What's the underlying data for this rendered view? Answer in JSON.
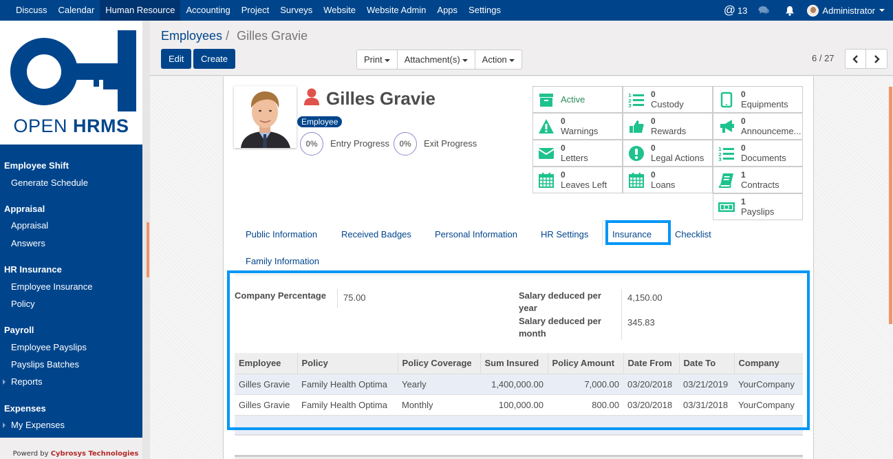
{
  "topbar": {
    "menu": [
      "Discuss",
      "Calendar",
      "Human Resource",
      "Accounting",
      "Project",
      "Surveys",
      "Website",
      "Website Admin",
      "Apps",
      "Settings"
    ],
    "active_index": 2,
    "mentions_count": "13",
    "user": "Administrator"
  },
  "logo": {
    "text_light": "OPEN ",
    "text_bold": "HRMS"
  },
  "sidebar": {
    "sections": [
      {
        "title": "Employee Shift",
        "items": [
          {
            "label": "Generate Schedule",
            "expandable": false
          }
        ]
      },
      {
        "title": "Appraisal",
        "items": [
          {
            "label": "Appraisal",
            "expandable": false
          },
          {
            "label": "Answers",
            "expandable": false
          }
        ]
      },
      {
        "title": "HR Insurance",
        "items": [
          {
            "label": "Employee Insurance",
            "expandable": false
          },
          {
            "label": "Policy",
            "expandable": false
          }
        ]
      },
      {
        "title": "Payroll",
        "items": [
          {
            "label": "Employee Payslips",
            "expandable": false
          },
          {
            "label": "Payslips Batches",
            "expandable": false
          },
          {
            "label": "Reports",
            "expandable": true
          }
        ]
      },
      {
        "title": "Expenses",
        "items": [
          {
            "label": "My Expenses",
            "expandable": true
          }
        ]
      }
    ],
    "powered_prefix": "Powerd by ",
    "powered_brand": "Cybrosys Technologies"
  },
  "control": {
    "breadcrumb_parent": "Employees",
    "breadcrumb_sep": "/",
    "breadcrumb_current": "Gilles Gravie",
    "edit_label": "Edit",
    "create_label": "Create",
    "print_label": "Print",
    "attachments_label": "Attachment(s)",
    "action_label": "Action",
    "pager": "6 / 27"
  },
  "employee": {
    "name": "Gilles Gravie",
    "tag": "Employee",
    "entry_progress": "0%",
    "entry_label": "Entry Progress",
    "exit_progress": "0%",
    "exit_label": "Exit Progress"
  },
  "stats": [
    {
      "icon": "archive-icon",
      "value": "",
      "label": "Active"
    },
    {
      "icon": "ordered-list-icon",
      "value": "0",
      "label": "Custody"
    },
    {
      "icon": "tablet-icon",
      "value": "0",
      "label": "Equipments"
    },
    {
      "icon": "warning-icon",
      "value": "0",
      "label": "Warnings"
    },
    {
      "icon": "thumbs-up-icon",
      "value": "0",
      "label": "Rewards"
    },
    {
      "icon": "bullhorn-icon",
      "value": "0",
      "label": "Announceme..."
    },
    {
      "icon": "envelope-icon",
      "value": "0",
      "label": "Letters"
    },
    {
      "icon": "exclamation-circle-icon",
      "value": "0",
      "label": "Legal Actions"
    },
    {
      "icon": "ordered-list-icon",
      "value": "0",
      "label": "Documents"
    },
    {
      "icon": "calendar-icon",
      "value": "0",
      "label": "Leaves Left"
    },
    {
      "icon": "calendar-icon",
      "value": "0",
      "label": "Loans"
    },
    {
      "icon": "book-icon",
      "value": "1",
      "label": "Contracts"
    },
    {
      "icon": "money-icon",
      "value": "1",
      "label": "Payslips"
    }
  ],
  "tabs": [
    "Public Information",
    "Received Badges",
    "Personal Information",
    "HR Settings",
    "Insurance",
    "Checklist",
    "Family Information"
  ],
  "active_tab": "Insurance",
  "insurance": {
    "company_percentage_label": "Company Percentage",
    "company_percentage": "75.00",
    "salary_year_label": "Salary deduced per year",
    "salary_year": "4,150.00",
    "salary_month_label": "Salary deduced per month",
    "salary_month": "345.83",
    "columns": [
      "Employee",
      "Policy",
      "Policy Coverage",
      "Sum Insured",
      "Policy Amount",
      "Date From",
      "Date To",
      "Company"
    ],
    "rows": [
      [
        "Gilles Gravie",
        "Family Health Optima",
        "Yearly",
        "1,400,000.00",
        "7,000.00",
        "03/20/2018",
        "03/21/2019",
        "YourCompany"
      ],
      [
        "Gilles Gravie",
        "Family Health Optima",
        "Monthly",
        "100,000.00",
        "800.00",
        "03/20/2018",
        "03/31/2018",
        "YourCompany"
      ]
    ]
  },
  "colors": {
    "brand": "#00458c",
    "accent_green": "#1ec28e",
    "highlight": "#0096f5",
    "user_icon": "#e0534c"
  }
}
